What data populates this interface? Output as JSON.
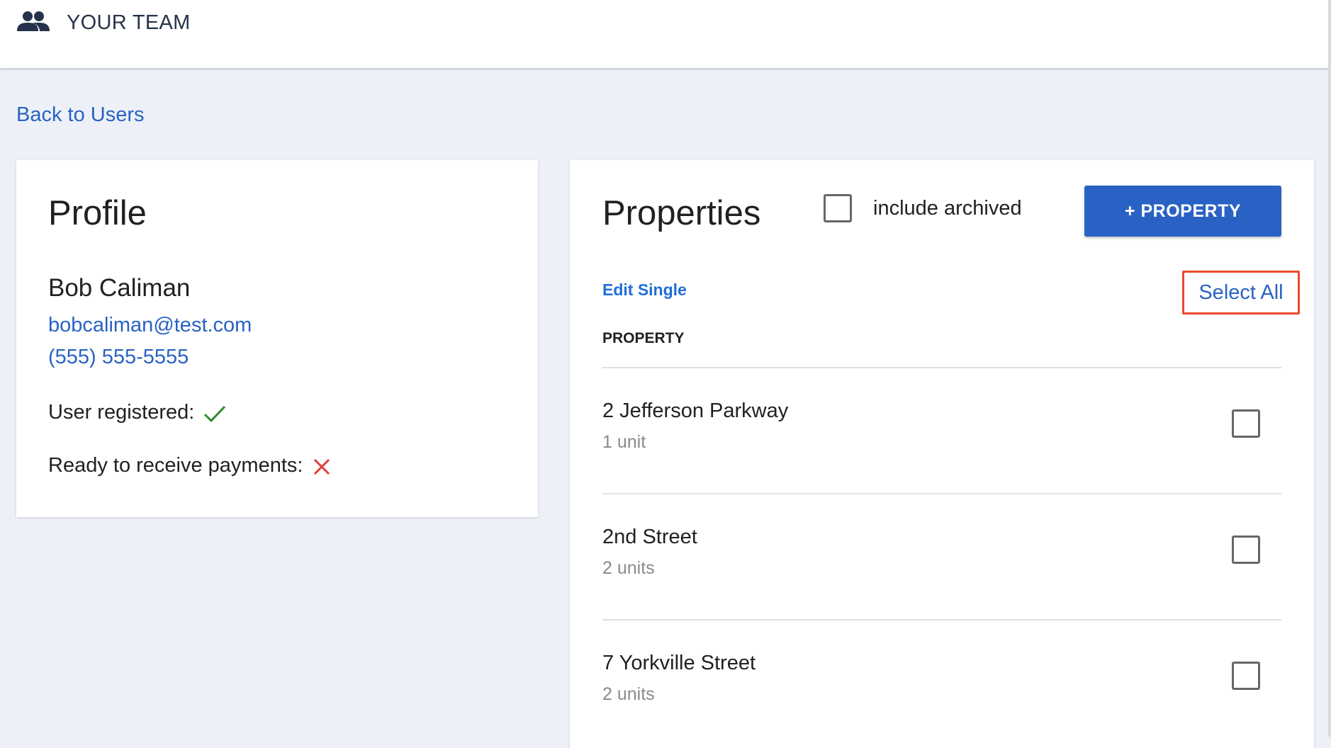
{
  "header": {
    "icon": "team-icon",
    "title": "YOUR TEAM"
  },
  "back_link": "Back to Users",
  "profile": {
    "title": "Profile",
    "name": "Bob Caliman",
    "email": "bobcaliman@test.com",
    "phone": "(555) 555-5555",
    "registered_label": "User registered:",
    "registered_icon": "check-icon",
    "payments_label": "Ready to receive payments:",
    "payments_icon": "cross-icon"
  },
  "properties": {
    "title": "Properties",
    "include_archived_label": "include archived",
    "include_archived_checked": false,
    "add_button_label": "+ PROPERTY",
    "edit_single_label": "Edit Single",
    "select_all_label": "Select All",
    "column_header": "PROPERTY",
    "items": [
      {
        "name": "2 Jefferson Parkway",
        "units": "1 unit",
        "checked": false
      },
      {
        "name": "2nd Street",
        "units": "2 units",
        "checked": false
      },
      {
        "name": "7 Yorkville Street",
        "units": "2 units",
        "checked": false
      }
    ]
  },
  "colors": {
    "accent": "#2962c4",
    "link": "#1f6fd8",
    "success": "#2e8b2e",
    "error": "#e53935",
    "highlight_border": "#e8492c",
    "background": "#edf1f7"
  }
}
